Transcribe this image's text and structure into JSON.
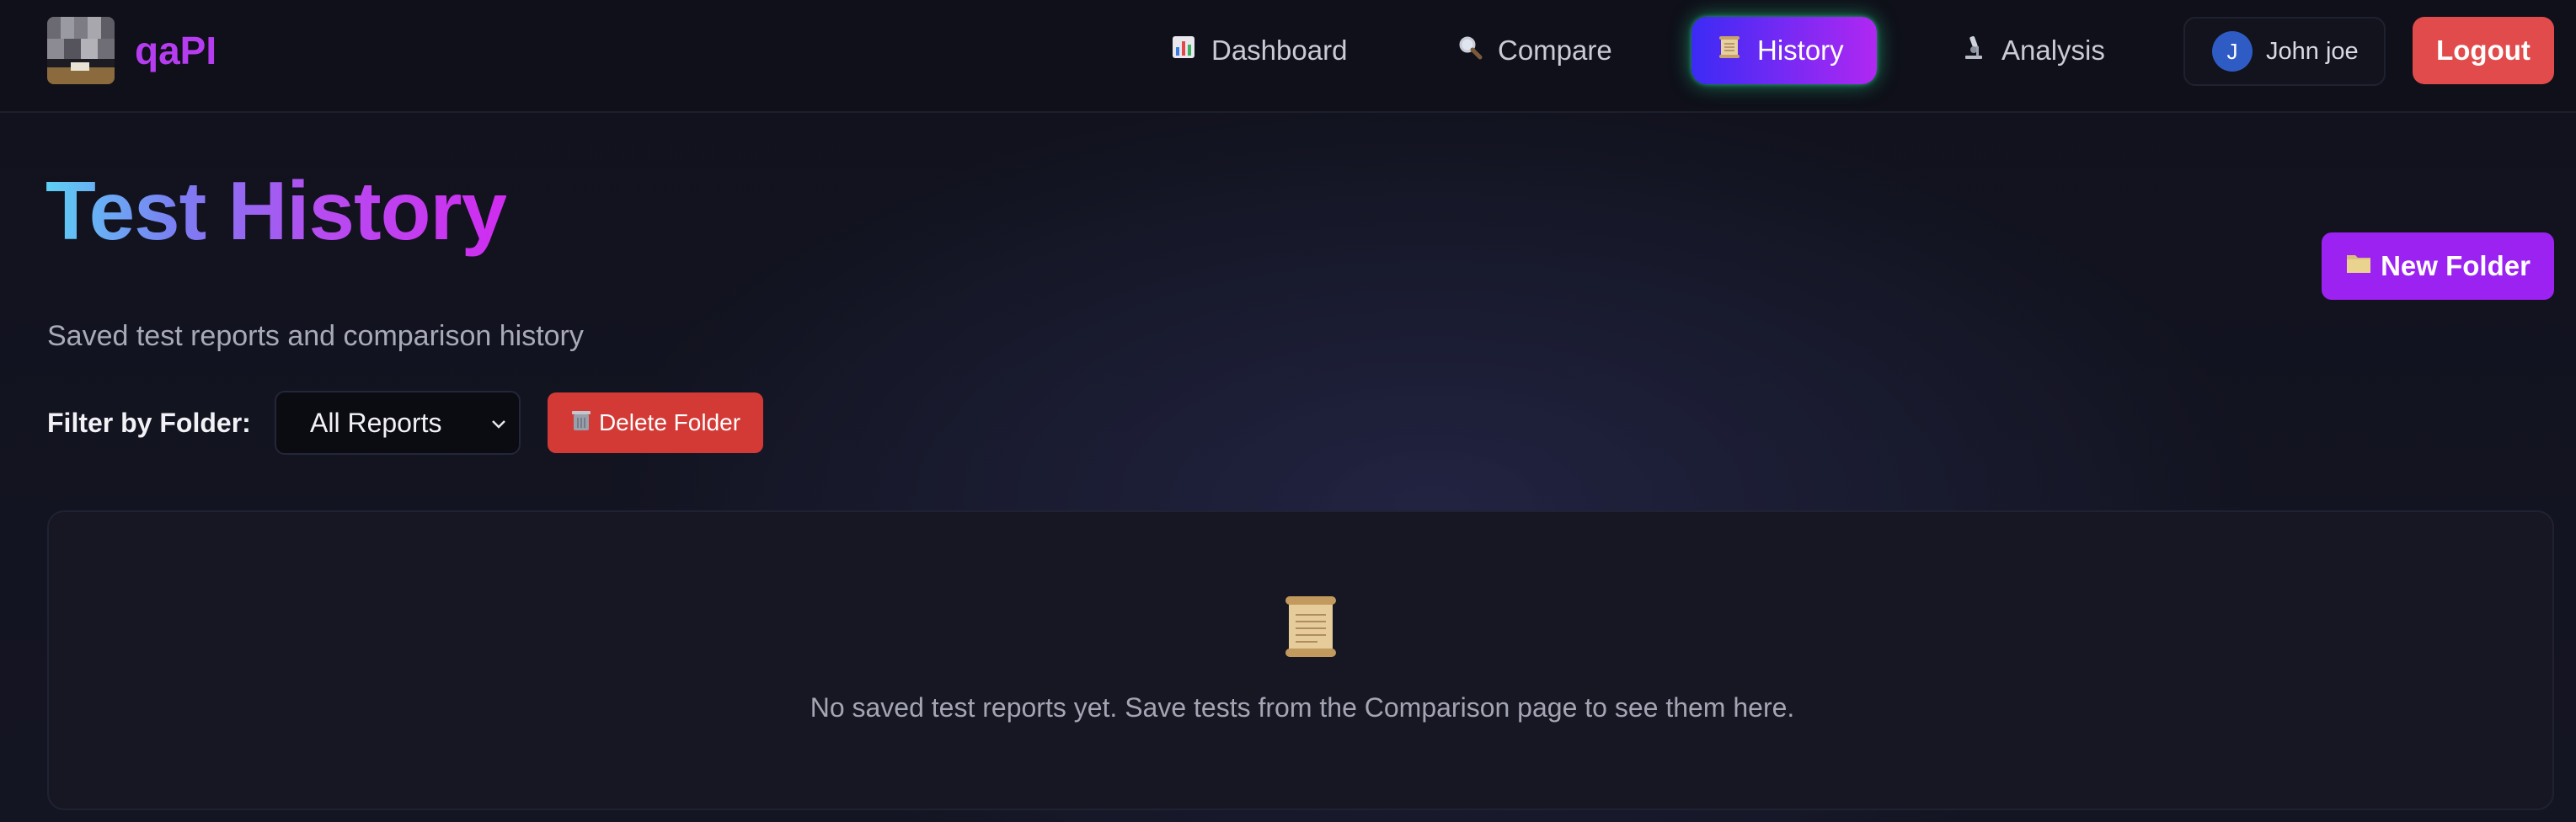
{
  "header": {
    "brand": "qaPI",
    "nav": [
      {
        "id": "dashboard",
        "label": "Dashboard",
        "icon": "bar-chart-icon"
      },
      {
        "id": "compare",
        "label": "Compare",
        "icon": "magnifier-icon"
      },
      {
        "id": "history",
        "label": "History",
        "icon": "scroll-icon",
        "active": true
      },
      {
        "id": "analysis",
        "label": "Analysis",
        "icon": "microscope-icon"
      }
    ],
    "user": {
      "initial": "J",
      "name": "John joe"
    },
    "logout_label": "Logout"
  },
  "page": {
    "title_part1": "Test ",
    "title_part2": "History",
    "subtitle": "Saved test reports and comparison history",
    "new_folder_label": "New Folder"
  },
  "filter": {
    "label": "Filter by Folder:",
    "selected": "All Reports",
    "delete_label": "Delete Folder"
  },
  "empty_state": {
    "icon": "scroll-icon",
    "message": "No saved test reports yet. Save tests from the Comparison page to see them here."
  },
  "colors": {
    "active_nav_start": "#3b2bf5",
    "active_nav_end": "#b028f2",
    "logout": "#e14b4b",
    "new_folder": "#9b22f0",
    "delete": "#d33a36",
    "brand": "#b63cf0"
  }
}
